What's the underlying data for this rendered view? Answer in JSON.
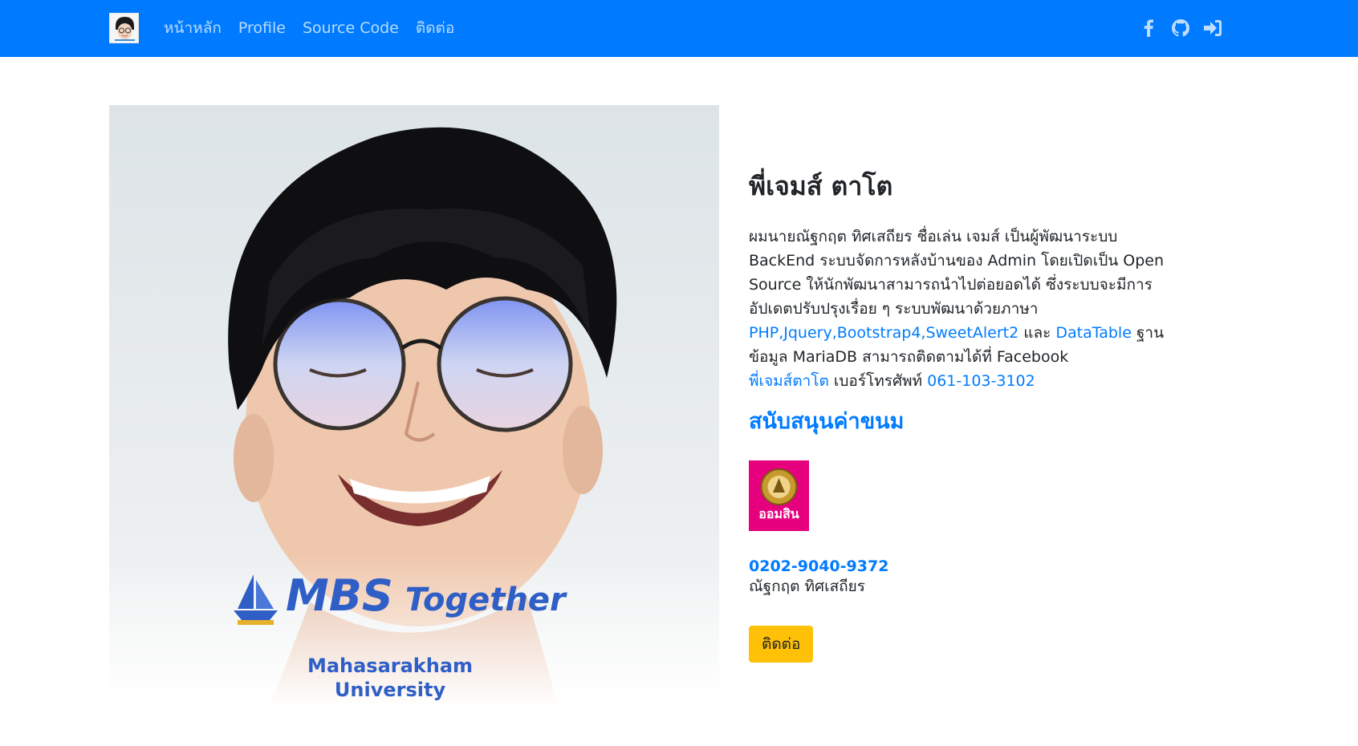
{
  "nav": {
    "links": [
      "หน้าหลัก",
      "Profile",
      "Source Code",
      "ติดต่อ"
    ],
    "icons": [
      "facebook-icon",
      "github-icon",
      "sign-in-icon"
    ]
  },
  "photo": {
    "caption_main": "MBS",
    "caption_sub": "Together",
    "caption_line1": "Mahasarakham",
    "caption_line2": "University"
  },
  "profile": {
    "name": "พี่เจมส์ ตาโต",
    "bio_1": "ผมนายณัฐกฤต ทิศเสถียร ชื่อเล่น เจมส์ เป็นผู้พัฒนาระบบ BackEnd ระบบจัดการหลังบ้านของ Admin โดยเปิดเป็น Open Source ให้นักพัฒนาสามารถนำไปต่อยอดได้ ซึ่งระบบจะมีการอัปเดตปรับปรุงเรื่อย ๆ ระบบพัฒนาด้วยภาษา",
    "bio_link_1": "PHP,Jquery,Bootstrap4,SweetAlert2",
    "bio_2": " และ ",
    "bio_link_2": "DataTable",
    "bio_3": " ฐานข้อมูล MariaDB สามารถติดตามได้ที่ Facebook",
    "bio_link_3": "พี่เจมส์ตาโต",
    "bio_4": " เบอร์โทรศัพท์ ",
    "bio_link_4": "061-103-3102"
  },
  "support": {
    "title": "สนับสนุนค่าขนม",
    "bank_logo_text": "ออมสิน",
    "account_number": "0202-9040-9372",
    "account_name": "ณัฐกฤต ทิศเสถียร",
    "contact_button": "ติดต่อ"
  },
  "colors": {
    "navbar": "#007bff",
    "link": "#007bff",
    "button": "#ffc107",
    "bank": "#e6007e"
  }
}
